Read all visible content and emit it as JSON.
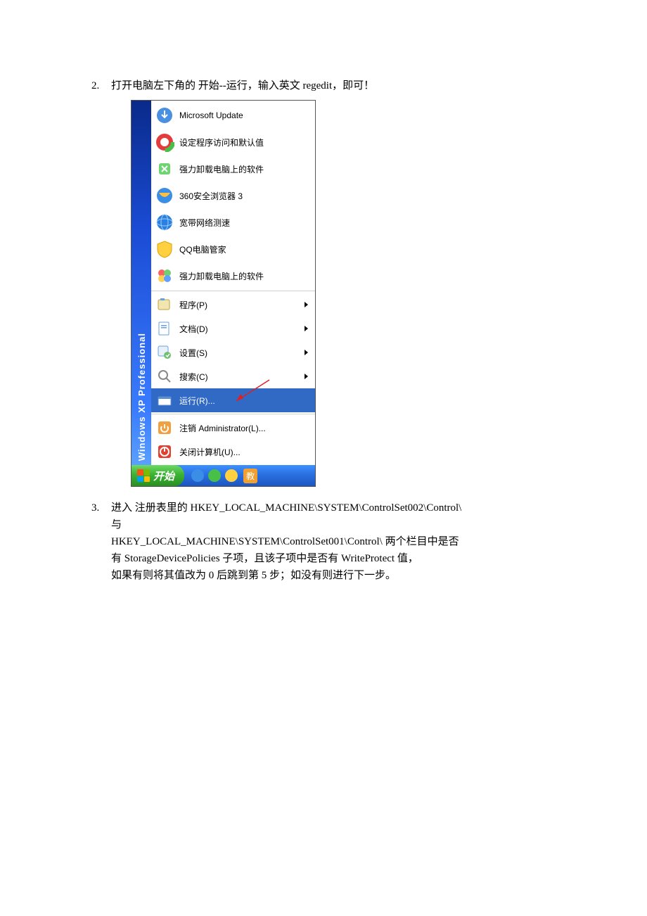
{
  "step2": {
    "num": "2.",
    "text": "打开电脑左下角的 开始--运行，输入英文 regedit，即可！"
  },
  "startmenu": {
    "side_label": "Windows XP  Professional",
    "sec1": [
      {
        "icon": "update",
        "label": "Microsoft Update"
      },
      {
        "icon": "defaults",
        "label": "设定程序访问和默认值"
      },
      {
        "icon": "uninstall",
        "label": "强力卸载电脑上的软件"
      },
      {
        "icon": "360",
        "label": "360安全浏览器 3"
      },
      {
        "icon": "net",
        "label": "宽带网络测速"
      },
      {
        "icon": "qq",
        "label": "QQ电脑管家"
      },
      {
        "icon": "uninstall2",
        "label": "强力卸载电脑上的软件"
      }
    ],
    "sec2": [
      {
        "icon": "programs",
        "label": "程序(P)",
        "arrow": true
      },
      {
        "icon": "docs",
        "label": "文档(D)",
        "arrow": true
      },
      {
        "icon": "settings",
        "label": "设置(S)",
        "arrow": true
      },
      {
        "icon": "search",
        "label": "搜索(C)",
        "arrow": true
      },
      {
        "icon": "run",
        "label": "运行(R)...",
        "selected": true,
        "anno": true
      }
    ],
    "sec3": [
      {
        "icon": "logoff",
        "label": "注销 Administrator(L)..."
      },
      {
        "icon": "shutdown",
        "label": "关闭计算机(U)..."
      }
    ]
  },
  "taskbar": {
    "start": "开始",
    "app": "教"
  },
  "step3": {
    "num": "3.",
    "l1": "进入 注册表里的 HKEY_LOCAL_MACHINE\\SYSTEM\\ControlSet002\\Control\\",
    "l2": "与",
    "l3": "HKEY_LOCAL_MACHINE\\SYSTEM\\ControlSet001\\Control\\ 两个栏目中是否",
    "l4": "有 StorageDevicePolicies 子项，且该子项中是否有 WriteProtect 值，",
    "l5": "如果有则将其值改为 0 后跳到第 5 步；如没有则进行下一步。"
  }
}
